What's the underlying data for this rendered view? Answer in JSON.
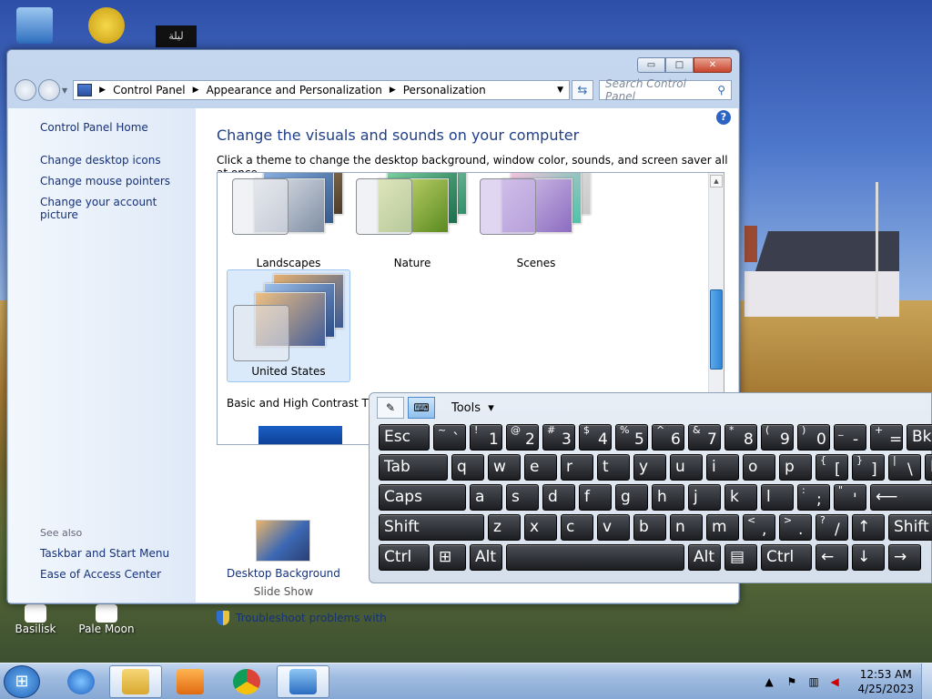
{
  "desktop": {
    "icons": [
      {
        "label": "Basilisk"
      },
      {
        "label": "Pale Moon"
      }
    ],
    "top_icon_text": "ليلة"
  },
  "window": {
    "address": {
      "segments": [
        "Control Panel",
        "Appearance and Personalization",
        "Personalization"
      ]
    },
    "search_placeholder": "Search Control Panel",
    "caption": {
      "min": "▭",
      "max": "□",
      "close": "✕"
    }
  },
  "left_pane": {
    "home": "Control Panel Home",
    "links": [
      "Change desktop icons",
      "Change mouse pointers",
      "Change your account picture"
    ],
    "see_also_label": "See also",
    "see_also": [
      "Taskbar and Start Menu",
      "Ease of Access Center"
    ]
  },
  "main": {
    "heading": "Change the visuals and sounds on your computer",
    "subheading": "Click a theme to change the desktop background, window color, sounds, and screen saver all at once.",
    "themes": [
      {
        "label": "Landscapes"
      },
      {
        "label": "Nature"
      },
      {
        "label": "Scenes"
      },
      {
        "label": "United States"
      }
    ],
    "section_label": "Basic and High Contrast Them",
    "desktop_background": {
      "title": "Desktop Background",
      "value": "Slide Show"
    },
    "troubleshoot": "Troubleshoot problems with"
  },
  "osk": {
    "tools_label": "Tools",
    "rows": [
      [
        {
          "t": "Esc"
        },
        {
          "s": "~",
          "t": "`"
        },
        {
          "s": "!",
          "t": "1"
        },
        {
          "s": "@",
          "t": "2"
        },
        {
          "s": "#",
          "t": "3"
        },
        {
          "s": "$",
          "t": "4"
        },
        {
          "s": "%",
          "t": "5"
        },
        {
          "s": "^",
          "t": "6"
        },
        {
          "s": "&",
          "t": "7"
        },
        {
          "s": "*",
          "t": "8"
        },
        {
          "s": "(",
          "t": "9"
        },
        {
          "s": ")",
          "t": "0"
        },
        {
          "s": "_",
          "t": "-"
        },
        {
          "s": "+",
          "t": "="
        },
        {
          "t": "Bks"
        }
      ],
      [
        {
          "t": "Tab"
        },
        {
          "t": "q"
        },
        {
          "t": "w"
        },
        {
          "t": "e"
        },
        {
          "t": "r"
        },
        {
          "t": "t"
        },
        {
          "t": "y"
        },
        {
          "t": "u"
        },
        {
          "t": "i"
        },
        {
          "t": "o"
        },
        {
          "t": "p"
        },
        {
          "s": "{",
          "t": "["
        },
        {
          "s": "}",
          "t": "]"
        },
        {
          "s": "|",
          "t": "\\"
        },
        {
          "t": "D"
        }
      ],
      [
        {
          "t": "Caps"
        },
        {
          "t": "a"
        },
        {
          "t": "s"
        },
        {
          "t": "d"
        },
        {
          "t": "f"
        },
        {
          "t": "g"
        },
        {
          "t": "h"
        },
        {
          "t": "j"
        },
        {
          "t": "k"
        },
        {
          "t": "l"
        },
        {
          "s": ":",
          "t": ";"
        },
        {
          "s": "\"",
          "t": "'"
        },
        {
          "t": "⟵"
        }
      ],
      [
        {
          "t": "Shift"
        },
        {
          "t": "z"
        },
        {
          "t": "x"
        },
        {
          "t": "c"
        },
        {
          "t": "v"
        },
        {
          "t": "b"
        },
        {
          "t": "n"
        },
        {
          "t": "m"
        },
        {
          "s": "<",
          "t": ","
        },
        {
          "s": ">",
          "t": "."
        },
        {
          "s": "?",
          "t": "/"
        },
        {
          "t": "↑"
        },
        {
          "t": "Shift"
        }
      ],
      [
        {
          "t": "Ctrl"
        },
        {
          "t": "⊞"
        },
        {
          "t": "Alt"
        },
        {
          "t": ""
        },
        {
          "t": "Alt"
        },
        {
          "t": "▤"
        },
        {
          "t": "Ctrl"
        },
        {
          "t": "←"
        },
        {
          "t": "↓"
        },
        {
          "t": "→"
        }
      ]
    ]
  },
  "taskbar": {
    "clock_time": "12:53 AM",
    "clock_date": "4/25/2023"
  }
}
